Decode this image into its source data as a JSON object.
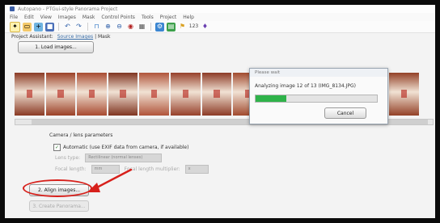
{
  "window": {
    "title": "Autopano - PTGui-style Panorama Project"
  },
  "menubar": {
    "items": [
      "File",
      "Edit",
      "View",
      "Images",
      "Mask",
      "Control Points",
      "Tools",
      "Project",
      "Help"
    ]
  },
  "toolbar": {
    "icons": [
      "new-project",
      "open-project",
      "add-images",
      "save-project",
      "undo",
      "redo",
      "panorama-editor",
      "zoom-in",
      "zoom-out",
      "preview",
      "table",
      "settings",
      "detail-viewer",
      "export",
      "help"
    ]
  },
  "breadcrumb": {
    "prefix": "Project Assistant",
    "link": "Source Images",
    "suffix": "Mask"
  },
  "step1": {
    "label": "1. Load images..."
  },
  "thumbnails": {
    "colors": [
      "#8a3a24",
      "#9b4026",
      "#a84a30",
      "#7f3420",
      "#b0543a",
      "#96402a",
      "#8c3b26",
      "#a14a2e",
      "#b25a40",
      "#7c3520",
      "#8f4029",
      "#a64c33",
      "#934127"
    ]
  },
  "camera_params": {
    "label": "Camera / lens parameters",
    "checkbox_label": "Automatic (use EXIF data from camera, if available)",
    "checked": true,
    "lens_type_label": "Lens type:",
    "lens_type_value": "Rectilinear (normal lenses)",
    "focal_label": "Focal length:",
    "focal_value": "mm",
    "multiplier_label": "Focal length multiplier:",
    "multiplier_value": "x"
  },
  "step2": {
    "label": "2. Align images..."
  },
  "step3": {
    "label": "3. Create Panorama..."
  },
  "progress_dialog": {
    "title": "Please wait",
    "message": "Analyzing image 12 of 13 (IMG_8134.JPG)",
    "progress": 0.25,
    "cancel_label": "Cancel"
  },
  "colors": {
    "annotation_red": "#d7201b",
    "progress_green": "#2fb34a"
  }
}
